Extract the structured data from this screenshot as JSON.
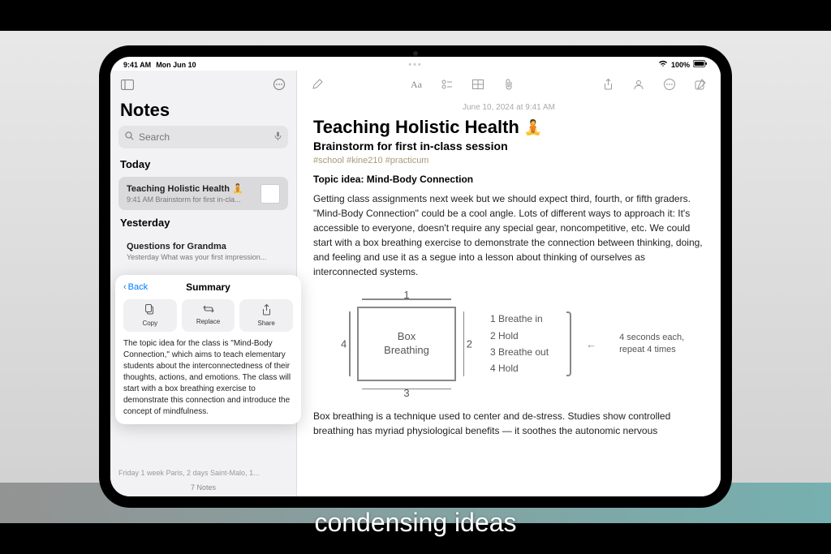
{
  "statusbar": {
    "time": "9:41 AM",
    "date": "Mon Jun 10",
    "battery": "100%"
  },
  "sidebar": {
    "title": "Notes",
    "search_placeholder": "Search",
    "sections": {
      "today": "Today",
      "yesterday": "Yesterday"
    },
    "items": [
      {
        "title": "Teaching Holistic Health 🧘",
        "meta": "9:41 AM  Brainstorm for first in-cla..."
      },
      {
        "title": "Questions for Grandma",
        "meta": "Yesterday  What was your first impression..."
      }
    ],
    "footer_preview": "Friday  1 week Paris, 2 days Saint-Malo, 1...",
    "count": "7 Notes"
  },
  "summary": {
    "back": "Back",
    "title": "Summary",
    "actions": {
      "copy": "Copy",
      "replace": "Replace",
      "share": "Share"
    },
    "body": "The topic idea for the class is \"Mind-Body Connection,\" which aims to teach elementary students about the interconnectedness of their thoughts, actions, and emotions. The class will start with a box breathing exercise to demonstrate this connection and introduce the concept of mindfulness."
  },
  "note": {
    "datestamp": "June 10, 2024 at 9:41 AM",
    "title": "Teaching Holistic Health",
    "emoji": "🧘",
    "subtitle": "Brainstorm for first in-class session",
    "tags": "#school #kine210 #practicum",
    "topic": "Topic idea: Mind-Body Connection",
    "para1": "Getting class assignments next week but we should expect third, fourth, or fifth graders. \"Mind-Body Connection\" could be a cool angle. Lots of different ways to approach it: It's accessible to everyone, doesn't require any special gear, noncompetitive, etc. We could start with a box breathing exercise to demonstrate the connection between thinking, doing, and feeling and use it as a segue into a lesson about thinking of ourselves as interconnected systems.",
    "diagram": {
      "box_label": "Box\nBreathing",
      "sides": [
        "1",
        "2",
        "3",
        "4"
      ],
      "steps": [
        "1  Breathe in",
        "2  Hold",
        "3  Breathe out",
        "4  Hold"
      ],
      "annotation": "4 seconds each,\nrepeat 4 times"
    },
    "para2": "Box breathing is a technique used to center and de-stress. Studies show controlled breathing has myriad physiological benefits — it soothes the autonomic nervous"
  },
  "caption": "condensing ideas",
  "toolbar": {
    "aa": "Aa"
  }
}
